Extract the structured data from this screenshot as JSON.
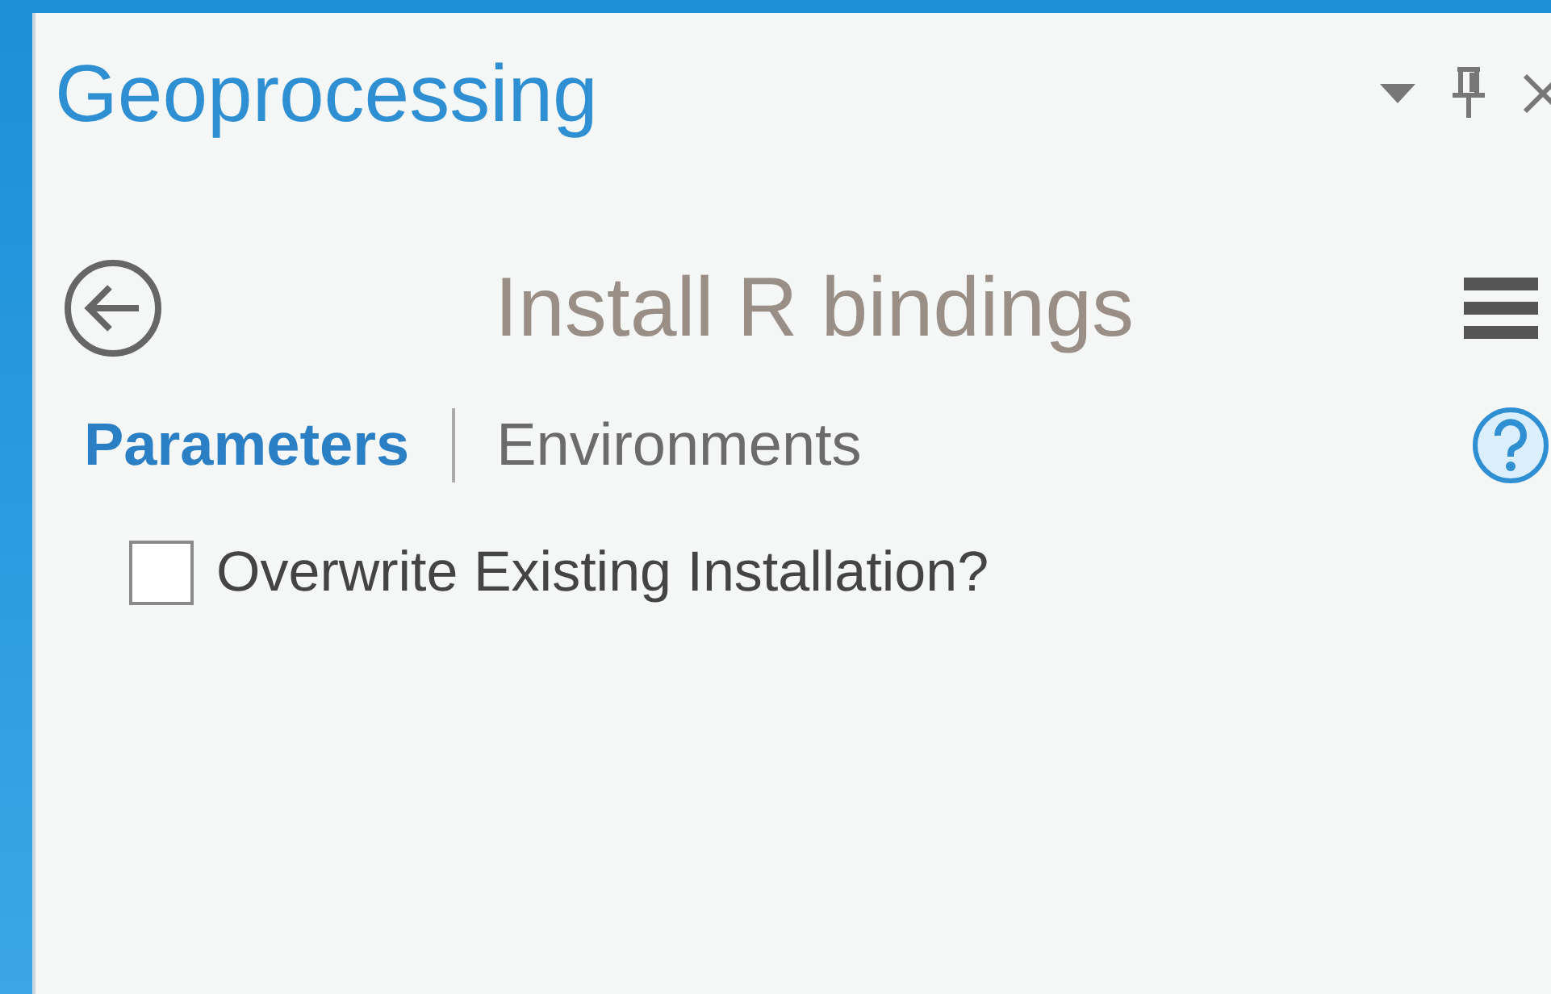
{
  "pane": {
    "title": "Geoprocessing"
  },
  "tool": {
    "title": "Install R bindings"
  },
  "tabs": [
    {
      "label": "Parameters",
      "selected": true
    },
    {
      "label": "Environments",
      "selected": false
    }
  ],
  "parameters": [
    {
      "label": "Overwrite Existing Installation?",
      "checked": false
    }
  ]
}
